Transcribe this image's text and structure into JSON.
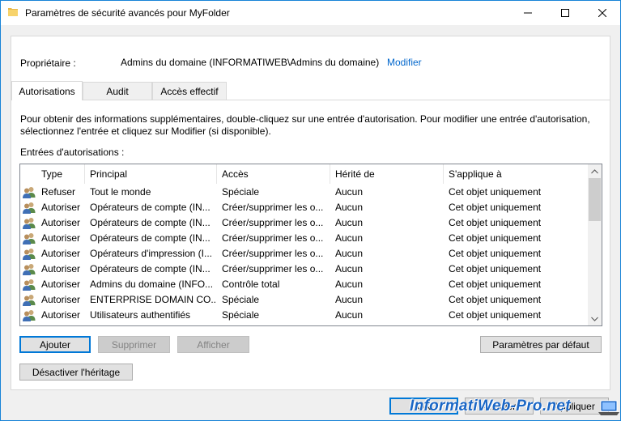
{
  "window": {
    "title": "Paramètres de sécurité avancés pour MyFolder"
  },
  "owner": {
    "label": "Propriétaire :",
    "value": "Admins du domaine (INFORMATIWEB\\Admins du domaine)",
    "change_link": "Modifier"
  },
  "tabs": [
    {
      "label": "Autorisations",
      "active": true
    },
    {
      "label": "Audit",
      "active": false
    },
    {
      "label": "Accès effectif",
      "active": false
    }
  ],
  "info_text": {
    "line1": "Pour obtenir des informations supplémentaires, double-cliquez sur une entrée d'autorisation. Pour modifier une entrée d'autorisation,",
    "line2": "sélectionnez l'entrée et cliquez sur Modifier (si disponible)."
  },
  "entries_label": "Entrées d'autorisations :",
  "table": {
    "headers": [
      "Type",
      "Principal",
      "Accès",
      "Hérité de",
      "S'applique à"
    ],
    "rows": [
      [
        "Refuser",
        "Tout le monde",
        "Spéciale",
        "Aucun",
        "Cet objet uniquement"
      ],
      [
        "Autoriser",
        "Opérateurs de compte (IN...",
        "Créer/supprimer les o...",
        "Aucun",
        "Cet objet uniquement"
      ],
      [
        "Autoriser",
        "Opérateurs de compte (IN...",
        "Créer/supprimer les o...",
        "Aucun",
        "Cet objet uniquement"
      ],
      [
        "Autoriser",
        "Opérateurs de compte (IN...",
        "Créer/supprimer les o...",
        "Aucun",
        "Cet objet uniquement"
      ],
      [
        "Autoriser",
        "Opérateurs d'impression (I...",
        "Créer/supprimer les o...",
        "Aucun",
        "Cet objet uniquement"
      ],
      [
        "Autoriser",
        "Opérateurs de compte (IN...",
        "Créer/supprimer les o...",
        "Aucun",
        "Cet objet uniquement"
      ],
      [
        "Autoriser",
        "Admins du domaine (INFO...",
        "Contrôle total",
        "Aucun",
        "Cet objet uniquement"
      ],
      [
        "Autoriser",
        "ENTERPRISE DOMAIN CO...",
        "Spéciale",
        "Aucun",
        "Cet objet uniquement"
      ],
      [
        "Autoriser",
        "Utilisateurs authentifiés",
        "Spéciale",
        "Aucun",
        "Cet objet uniquement"
      ]
    ]
  },
  "buttons": {
    "add": "Ajouter",
    "remove": "Supprimer",
    "view": "Afficher",
    "restore_defaults": "Paramètres par défaut",
    "disable_inheritance": "Désactiver l'héritage",
    "ok": "OK",
    "cancel": "Annuler",
    "apply": "Appliquer"
  },
  "watermark": "InformatiWeb-Pro.net",
  "colors": {
    "accent": "#0078d7",
    "link": "#0066cc",
    "watermark": "#1a66c5"
  },
  "icons": {
    "folder": "folder-icon",
    "user": "users-icon"
  }
}
